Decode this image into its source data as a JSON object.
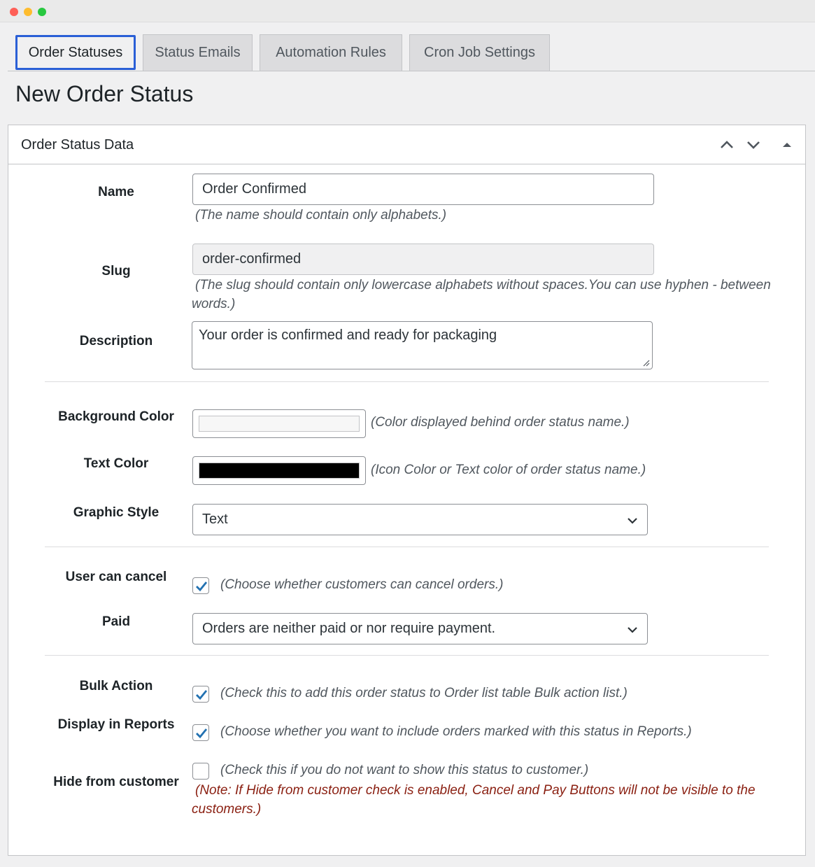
{
  "window": {
    "controls": [
      "close",
      "minimize",
      "maximize"
    ]
  },
  "tabs": [
    {
      "label": "Order Statuses",
      "active": true
    },
    {
      "label": "Status Emails",
      "active": false
    },
    {
      "label": "Automation Rules",
      "active": false
    },
    {
      "label": "Cron Job Settings",
      "active": false
    }
  ],
  "page_title": "New Order Status",
  "panel": {
    "title": "Order Status Data",
    "icons": [
      "chevron-up-icon",
      "chevron-down-icon",
      "triangle-up-icon"
    ]
  },
  "form": {
    "name": {
      "label": "Name",
      "value": "Order Confirmed",
      "help": "(The name should contain only alphabets.)"
    },
    "slug": {
      "label": "Slug",
      "value": "order-confirmed",
      "help_line1": "(The slug should contain only lowercase alphabets without spaces.You can use hyphen - between",
      "help_line2": "words.)"
    },
    "description": {
      "label": "Description",
      "value": "Your order is confirmed and ready for packaging"
    },
    "background_color": {
      "label": "Background Color",
      "value": "#f7f7f7",
      "help": "(Color displayed behind order status name.)"
    },
    "text_color": {
      "label": "Text Color",
      "value": "#000000",
      "help": "(Icon Color or Text color of order status name.)"
    },
    "graphic_style": {
      "label": "Graphic Style",
      "value": "Text"
    },
    "user_can_cancel": {
      "label": "User can cancel",
      "checked": true,
      "help": "(Choose whether customers can cancel orders.)"
    },
    "paid": {
      "label": "Paid",
      "value": "Orders are neither paid or nor require payment."
    },
    "bulk_action": {
      "label": "Bulk Action",
      "checked": true,
      "help": "(Check this to add this order status to Order list table Bulk action list.)"
    },
    "display_in_reports": {
      "label": "Display in Reports",
      "checked": true,
      "help": "(Choose whether you want to include orders marked with this status in Reports.)"
    },
    "hide_from_customer": {
      "label": "Hide from customer",
      "checked": false,
      "help": "(Check this if you do not want to show this status to customer.)",
      "note_line1": "(Note: If Hide from customer check is enabled, Cancel and Pay Buttons will not be visible to the",
      "note_line2": "customers.)"
    }
  },
  "colors": {
    "accent": "#2a5fd6",
    "check": "#2271b1",
    "note": "#8a1f11"
  }
}
